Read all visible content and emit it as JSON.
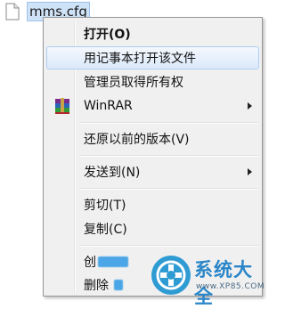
{
  "file": {
    "name": "mms.cfg",
    "icon": "document-icon"
  },
  "menu": {
    "items": [
      {
        "label": "打开(O)"
      },
      {
        "label": "用记事本打开该文件"
      },
      {
        "label": "管理员取得所有权"
      },
      {
        "label": "WinRAR",
        "icon": "winrar-icon"
      },
      {
        "label": "还原以前的版本(V)"
      },
      {
        "label": "发送到(N)"
      },
      {
        "label": "剪切(T)"
      },
      {
        "label": "复制(C)"
      },
      {
        "label": "创"
      },
      {
        "label": "删除"
      }
    ]
  },
  "watermark": {
    "title": "系统大全",
    "url": "www.XP85.COM"
  },
  "colors": {
    "hover_fill": "#dbe9fa",
    "hover_border": "#aecef4",
    "menu_bg": "#f0f0f0",
    "watermark_blue": "#2a86c8"
  }
}
